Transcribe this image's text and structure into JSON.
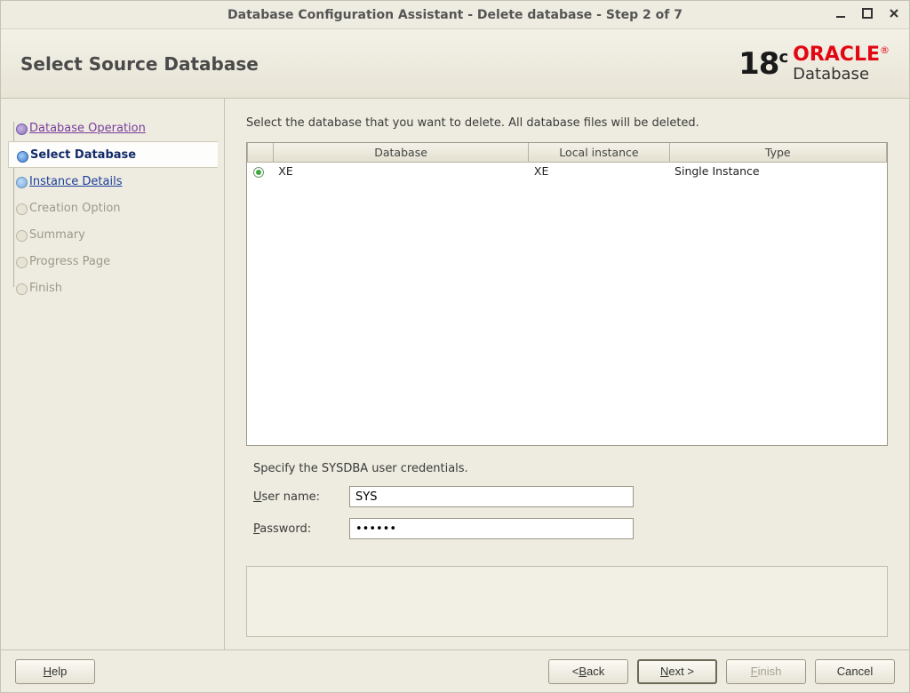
{
  "window": {
    "title": "Database Configuration Assistant - Delete database - Step 2 of 7"
  },
  "header": {
    "title": "Select Source Database",
    "brand_version": "18",
    "brand_suffix": "c",
    "brand_name": "ORACLE",
    "brand_reg": "®",
    "brand_product": "Database"
  },
  "sidebar": {
    "steps": [
      {
        "label": "Database Operation"
      },
      {
        "label": "Select Database"
      },
      {
        "label": "Instance Details"
      },
      {
        "label": "Creation Option"
      },
      {
        "label": "Summary"
      },
      {
        "label": "Progress Page"
      },
      {
        "label": "Finish"
      }
    ]
  },
  "main": {
    "instruction": "Select the database that you want to delete. All database files will be deleted.",
    "columns": {
      "c1": "Database",
      "c2": "Local instance",
      "c3": "Type"
    },
    "rows": [
      {
        "database": "XE",
        "local_instance": "XE",
        "type": "Single Instance"
      }
    ],
    "cred_title": "Specify the SYSDBA user credentials.",
    "username_label_u": "U",
    "username_label_rest": "ser name:",
    "username_value": "SYS",
    "password_label_u": "P",
    "password_label_rest": "assword:",
    "password_value": "••••••"
  },
  "footer": {
    "help_u": "H",
    "help_rest": "elp",
    "back_pre": "< ",
    "back_u": "B",
    "back_rest": "ack",
    "next_u": "N",
    "next_rest": "ext >",
    "finish_u": "F",
    "finish_rest": "inish",
    "cancel": "Cancel"
  }
}
